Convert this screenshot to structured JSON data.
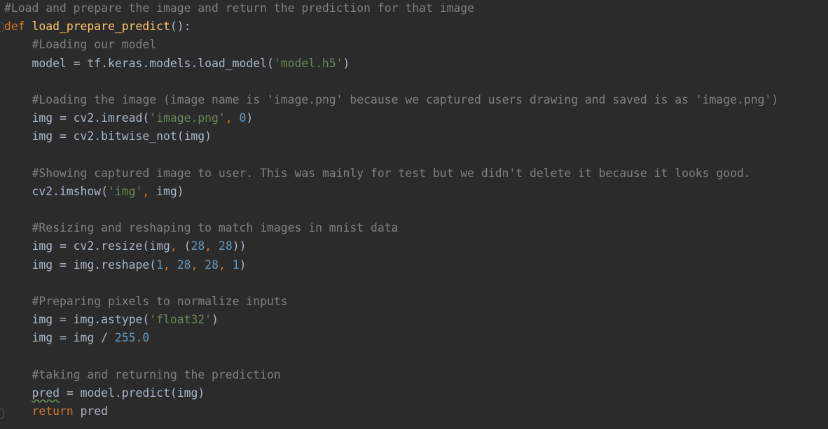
{
  "editor": {
    "theme_colors": {
      "background": "#2b2b2b",
      "text": "#a9b7c6",
      "comment": "#808080",
      "keyword": "#cc7832",
      "function": "#ffc66d",
      "string": "#6a8759",
      "number": "#6897bb"
    },
    "lines": [
      [
        [
          "comment",
          "#Load and prepare the image and return the prediction for that image"
        ]
      ],
      [
        [
          "keyword",
          "def "
        ],
        [
          "func",
          "load_prepare_predict"
        ],
        [
          "text",
          "():"
        ]
      ],
      [
        [
          "text",
          "    "
        ],
        [
          "comment",
          "#Loading our model"
        ]
      ],
      [
        [
          "text",
          "    model = tf.keras.models.load_model("
        ],
        [
          "string",
          "'model.h5'"
        ],
        [
          "text",
          ")"
        ]
      ],
      [],
      [
        [
          "text",
          "    "
        ],
        [
          "comment",
          "#Loading the image (image name is 'image.png' because we captured users drawing and saved is as 'image.png')"
        ]
      ],
      [
        [
          "text",
          "    img = cv2.imread("
        ],
        [
          "string",
          "'image.png'"
        ],
        [
          "keyword",
          ", "
        ],
        [
          "number",
          "0"
        ],
        [
          "text",
          ")"
        ]
      ],
      [
        [
          "text",
          "    img = cv2.bitwise_not(img)"
        ]
      ],
      [],
      [
        [
          "text",
          "    "
        ],
        [
          "comment",
          "#Showing captured image to user. This was mainly for test but we didn't delete it because it looks good."
        ]
      ],
      [
        [
          "text",
          "    cv2.imshow("
        ],
        [
          "string",
          "'img'"
        ],
        [
          "keyword",
          ", "
        ],
        [
          "text",
          "img)"
        ]
      ],
      [],
      [
        [
          "text",
          "    "
        ],
        [
          "comment",
          "#Resizing and reshaping to match images in mnist data"
        ]
      ],
      [
        [
          "text",
          "    img = cv2.resize(img"
        ],
        [
          "keyword",
          ", "
        ],
        [
          "text",
          "("
        ],
        [
          "number",
          "28"
        ],
        [
          "keyword",
          ", "
        ],
        [
          "number",
          "28"
        ],
        [
          "text",
          "))"
        ]
      ],
      [
        [
          "text",
          "    img = img.reshape("
        ],
        [
          "number",
          "1"
        ],
        [
          "keyword",
          ", "
        ],
        [
          "number",
          "28"
        ],
        [
          "keyword",
          ", "
        ],
        [
          "number",
          "28"
        ],
        [
          "keyword",
          ", "
        ],
        [
          "number",
          "1"
        ],
        [
          "text",
          ")"
        ]
      ],
      [],
      [
        [
          "text",
          "    "
        ],
        [
          "comment",
          "#Preparing pixels to normalize inputs"
        ]
      ],
      [
        [
          "text",
          "    img = img.astype("
        ],
        [
          "string",
          "'float32'"
        ],
        [
          "text",
          ")"
        ]
      ],
      [
        [
          "text",
          "    img = img / "
        ],
        [
          "number",
          "255.0"
        ]
      ],
      [],
      [
        [
          "text",
          "    "
        ],
        [
          "comment",
          "#taking and returning the prediction"
        ]
      ],
      [
        [
          "text",
          "    "
        ],
        [
          "warn",
          "pred"
        ],
        [
          "text",
          " = model.predict(img)"
        ]
      ],
      [
        [
          "text",
          "    "
        ],
        [
          "keyword",
          "return "
        ],
        [
          "text",
          "pred"
        ]
      ]
    ]
  }
}
